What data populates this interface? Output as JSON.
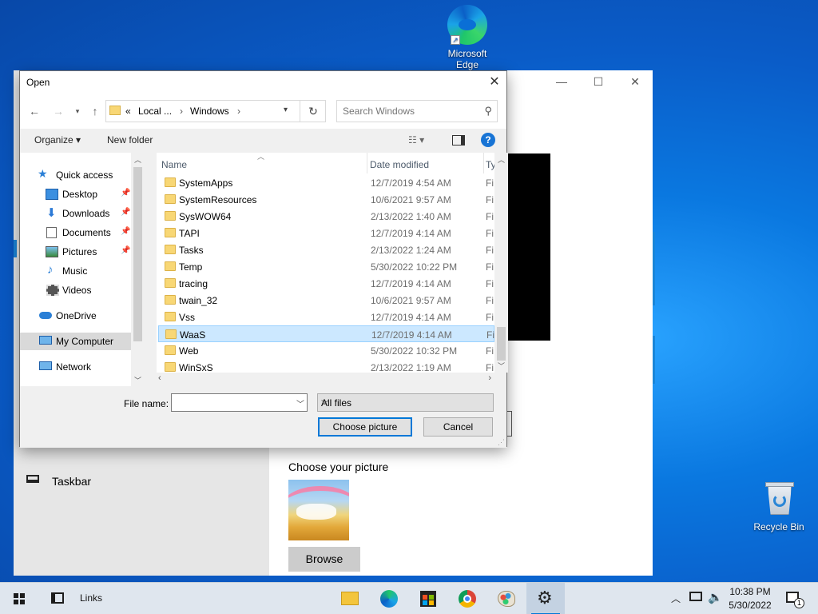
{
  "desktop": {
    "icons": [
      {
        "label": "Microsoft Edge"
      },
      {
        "label": "Recycle Bin"
      }
    ]
  },
  "settings_window": {
    "section_label": "Choose your picture",
    "browse_label": "Browse",
    "sidebar_item_taskbar": "Taskbar"
  },
  "dialog": {
    "title": "Open",
    "close_glyph": "✕",
    "address": {
      "chevron": "«",
      "segments": [
        "Local ...",
        "Windows"
      ],
      "separator": "›"
    },
    "search_placeholder": "Search Windows",
    "toolbar": {
      "organize": "Organize ▾",
      "new_folder": "New folder",
      "help": "?"
    },
    "nav": [
      {
        "label": "Quick access",
        "icon": "star-icon"
      },
      {
        "label": "Desktop",
        "icon": "desktop-icon",
        "pinned": true
      },
      {
        "label": "Downloads",
        "icon": "download-icon",
        "pinned": true
      },
      {
        "label": "Documents",
        "icon": "document-icon",
        "pinned": true
      },
      {
        "label": "Pictures",
        "icon": "pictures-icon",
        "pinned": true
      },
      {
        "label": "Music",
        "icon": "music-icon"
      },
      {
        "label": "Videos",
        "icon": "videos-icon"
      },
      {
        "label": "OneDrive",
        "icon": "cloud-icon"
      },
      {
        "label": "My Computer",
        "icon": "computer-icon",
        "selected": true
      },
      {
        "label": "Network",
        "icon": "network-icon"
      }
    ],
    "columns": {
      "name": "Name",
      "date": "Date modified",
      "type": "Ty"
    },
    "rows": [
      {
        "name": "SystemApps",
        "date": "12/7/2019 4:54 AM",
        "type": "Fi"
      },
      {
        "name": "SystemResources",
        "date": "10/6/2021 9:57 AM",
        "type": "Fi"
      },
      {
        "name": "SysWOW64",
        "date": "2/13/2022 1:40 AM",
        "type": "Fi"
      },
      {
        "name": "TAPI",
        "date": "12/7/2019 4:14 AM",
        "type": "Fi"
      },
      {
        "name": "Tasks",
        "date": "2/13/2022 1:24 AM",
        "type": "Fi"
      },
      {
        "name": "Temp",
        "date": "5/30/2022 10:22 PM",
        "type": "Fi"
      },
      {
        "name": "tracing",
        "date": "12/7/2019 4:14 AM",
        "type": "Fi"
      },
      {
        "name": "twain_32",
        "date": "10/6/2021 9:57 AM",
        "type": "Fi"
      },
      {
        "name": "Vss",
        "date": "12/7/2019 4:14 AM",
        "type": "Fi"
      },
      {
        "name": "WaaS",
        "date": "12/7/2019 4:14 AM",
        "type": "Fi",
        "selected": true
      },
      {
        "name": "Web",
        "date": "5/30/2022 10:32 PM",
        "type": "Fi"
      },
      {
        "name": "WinSxS",
        "date": "2/13/2022 1:19 AM",
        "type": "Fi"
      }
    ],
    "file_name_label": "File name:",
    "file_name_value": "",
    "filter_value": "All files",
    "choose_button": "Choose picture",
    "cancel_button": "Cancel"
  },
  "taskbar": {
    "links_label": "Links",
    "time": "10:38 PM",
    "date": "5/30/2022",
    "notification_count": "1",
    "accent_color": "#0078d7"
  }
}
